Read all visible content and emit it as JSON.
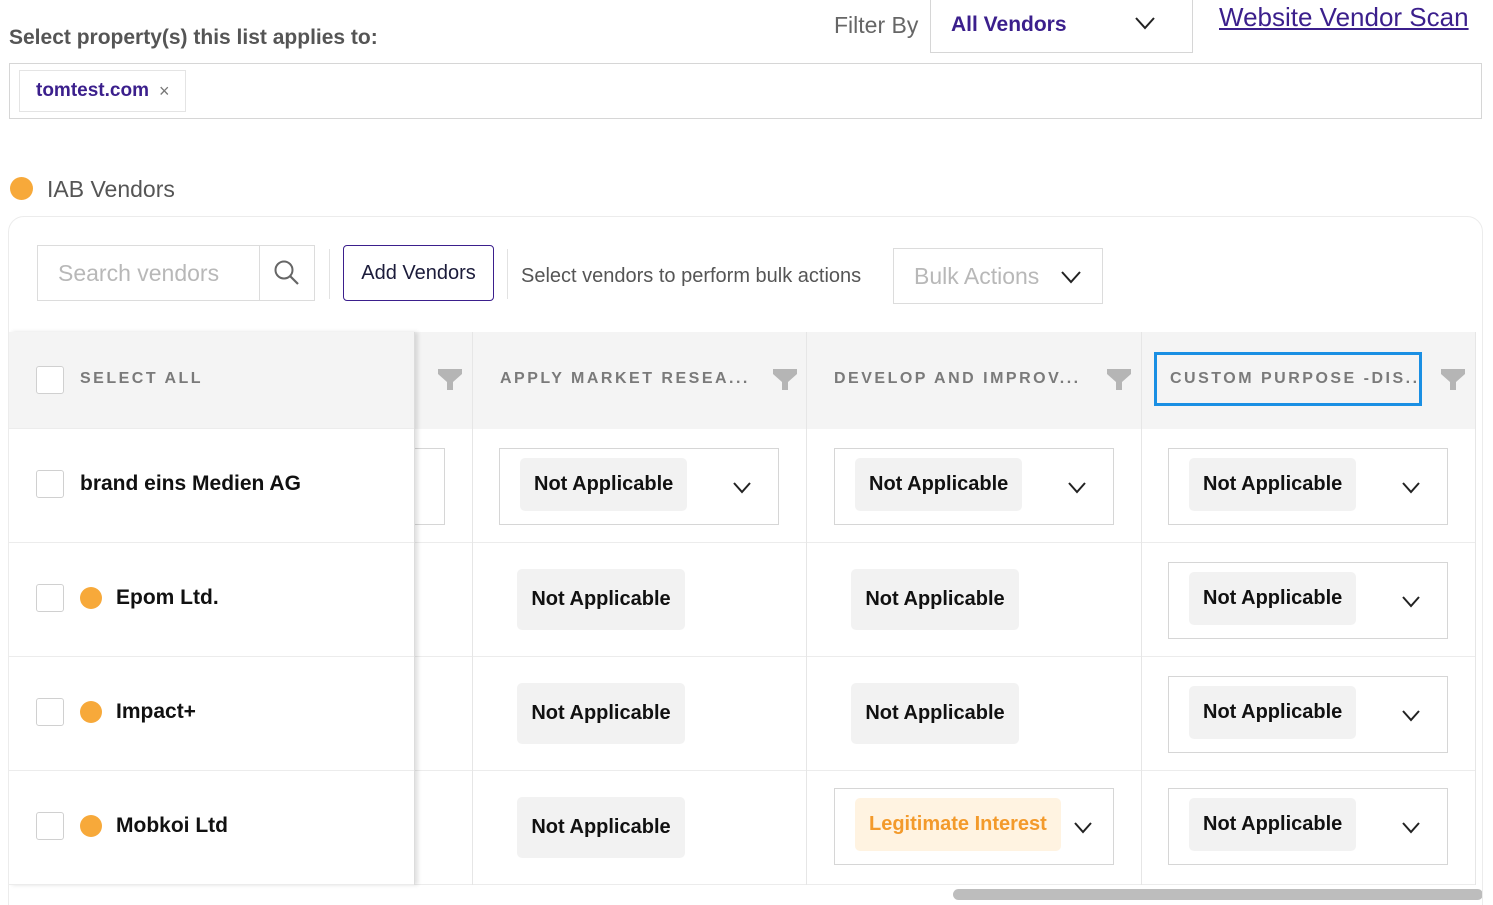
{
  "header": {
    "property_label": "Select property(s) this list applies to:",
    "filter_label": "Filter By",
    "filter_value": "All Vendors",
    "scan_link": "Website Vendor Scan"
  },
  "properties": [
    {
      "label": "tomtest.com",
      "remove": "×"
    }
  ],
  "section": {
    "title": "IAB Vendors",
    "dot_color": "#f7a93a"
  },
  "toolbar": {
    "search_placeholder": "Search vendors",
    "add_vendors": "Add Vendors",
    "bulk_hint": "Select vendors to perform bulk actions",
    "bulk_actions": "Bulk Actions"
  },
  "table": {
    "select_all": "SELECT ALL",
    "columns": [
      "APPLY MARKET RESEA...",
      "DEVELOP AND IMPROV...",
      "CUSTOM PURPOSE -DIS..."
    ],
    "rows": [
      {
        "vendor": "brand eins Medien AG",
        "iab": false,
        "cells": [
          "Not Applicable",
          "Not Applicable",
          "Not Applicable"
        ]
      },
      {
        "vendor": "Epom Ltd.",
        "iab": true,
        "cells": [
          "Not Applicable",
          "Not Applicable",
          "Not Applicable"
        ]
      },
      {
        "vendor": "Impact+",
        "iab": true,
        "cells": [
          "Not Applicable",
          "Not Applicable",
          "Not Applicable"
        ]
      },
      {
        "vendor": "Mobkoi Ltd",
        "iab": true,
        "cells": [
          "Not Applicable",
          "Legitimate Interest",
          "Not Applicable"
        ]
      }
    ]
  },
  "colors": {
    "brand": "#3b1f8c",
    "accent_dot": "#f7a93a",
    "focus_outline": "#1a8fe3",
    "legit_interest_text": "#f39a2b"
  }
}
